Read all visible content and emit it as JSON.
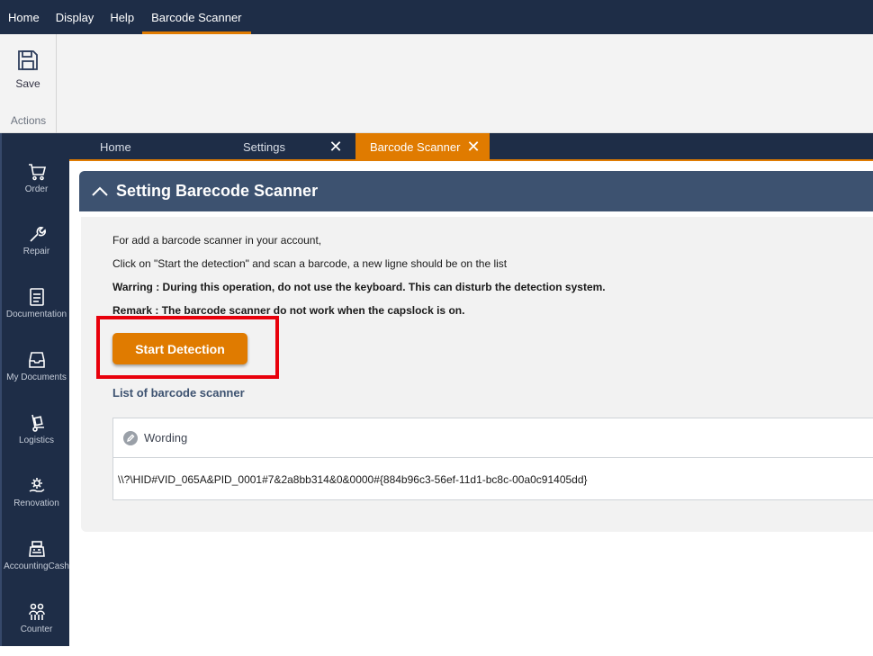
{
  "menubar": {
    "items": [
      "Home",
      "Display",
      "Help",
      "Barcode Scanner"
    ],
    "active": "Barcode Scanner",
    "accent": "#e07b00",
    "background": "#1e2d47"
  },
  "ribbon": {
    "save_label": "Save",
    "save_icon": "floppy-disk-icon",
    "group_label": "Actions"
  },
  "sidenav": {
    "items": [
      {
        "label": "Order",
        "icon": "cart-icon"
      },
      {
        "label": "Repair",
        "icon": "wrench-icon"
      },
      {
        "label": "Documentation",
        "icon": "document-icon"
      },
      {
        "label": "My Documents",
        "icon": "inbox-tray-icon"
      },
      {
        "label": "Logistics",
        "icon": "hand-truck-icon"
      },
      {
        "label": "Renovation",
        "icon": "gear-hand-icon"
      },
      {
        "label": "AccountingCash",
        "icon": "cash-register-icon"
      },
      {
        "label": "Counter",
        "icon": "people-icon"
      }
    ]
  },
  "tabs": {
    "items": [
      {
        "label": "Home",
        "closable": false
      },
      {
        "label": "Settings",
        "closable": true
      },
      {
        "label": "Barcode Scanner",
        "closable": true,
        "active": true
      }
    ],
    "close_glyph": "✕"
  },
  "section": {
    "title": "Setting Barecode Scanner",
    "line1": "For add a barcode scanner in your account,",
    "line2": "Click on \"Start the detection\" and scan a barcode, a new ligne should be on the list",
    "warning_label": "Warring :",
    "warning_text": " During this operation, do not use the keyboard. This can disturb the detection system.",
    "remark_label": "Remark :",
    "remark_text": " The barcode scanner do not work when the capslock is on.",
    "button_label": "Start Detection",
    "list_title": "List of barcode scanner",
    "grid": {
      "column": "Wording",
      "rows": [
        "\\\\?\\HID#VID_065A&PID_0001#7&2a8bb314&0&0000#{884b96c3-56ef-11d1-bc8c-00a0c91405dd}"
      ]
    }
  }
}
